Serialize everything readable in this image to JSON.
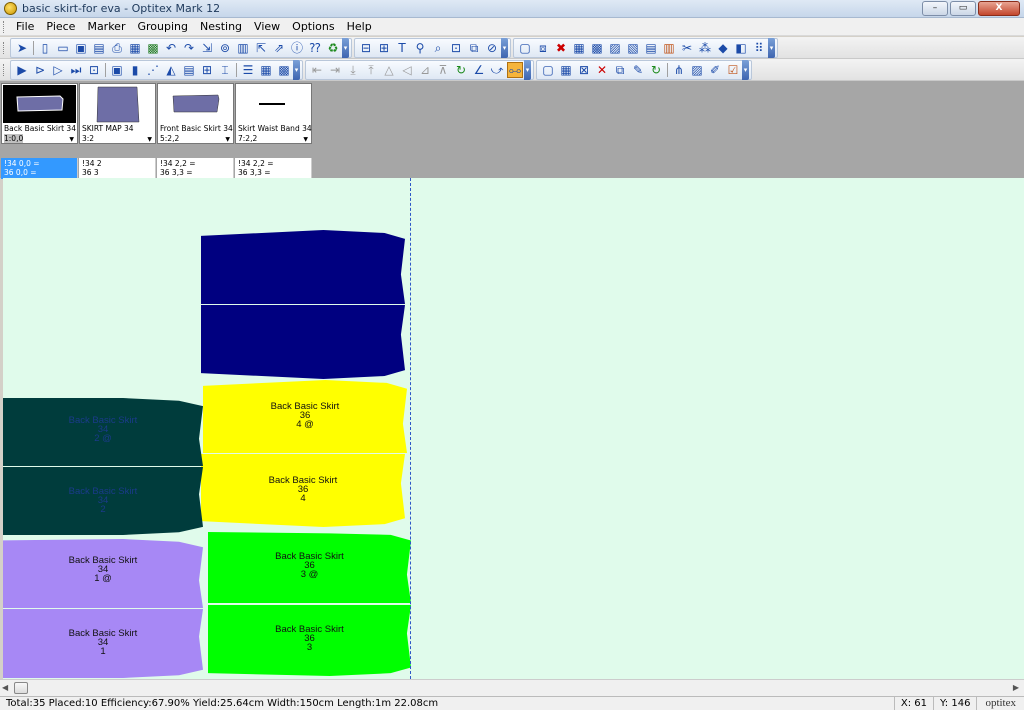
{
  "window": {
    "title": "basic skirt-for eva - Optitex Mark 12",
    "min": "–",
    "max": "▭",
    "close": "X"
  },
  "menu": [
    "File",
    "Piece",
    "Marker",
    "Grouping",
    "Nesting",
    "View",
    "Options",
    "Help"
  ],
  "thumbnails": [
    {
      "name": "Back Basic Skirt 34",
      "count": "1:0,0",
      "sizes": [
        "!34  0,0 =",
        "36  0,0 ="
      ],
      "selected": true
    },
    {
      "name": "SKIRT MAP 34",
      "count": "3:2",
      "sizes": [
        "!34  2",
        "36  3"
      ],
      "selected": false
    },
    {
      "name": "Front Basic Skirt 34",
      "count": "5:2,2",
      "sizes": [
        "!34  2,2 =",
        "36  3,3 ="
      ],
      "selected": false
    },
    {
      "name": "Skirt Waist Band 34",
      "count": "7:2,2",
      "sizes": [
        "!34  2,2 =",
        "36  3,3 ="
      ],
      "selected": false
    }
  ],
  "pieces": [
    {
      "id": "navy-top",
      "color": "#000080",
      "lines": [
        "",
        "",
        ""
      ]
    },
    {
      "id": "navy-bottom",
      "color": "#000080",
      "lines": [
        "",
        "",
        ""
      ]
    },
    {
      "id": "yellow-top",
      "color": "#ffff00",
      "lines": [
        "Back Basic Skirt",
        "36",
        "4 @"
      ]
    },
    {
      "id": "yellow-bottom",
      "color": "#ffff00",
      "lines": [
        "Back Basic Skirt",
        "36",
        "4"
      ]
    },
    {
      "id": "teal-top",
      "color": "#003c3c",
      "lines": [
        "Back Basic Skirt",
        "34",
        "2 @"
      ]
    },
    {
      "id": "teal-bottom",
      "color": "#003c3c",
      "lines": [
        "Back Basic Skirt",
        "34",
        "2"
      ]
    },
    {
      "id": "green-top",
      "color": "#00ff00",
      "lines": [
        "Back Basic Skirt",
        "36",
        "3 @"
      ]
    },
    {
      "id": "green-bottom",
      "color": "#00ff00",
      "lines": [
        "Back Basic Skirt",
        "36",
        "3"
      ]
    },
    {
      "id": "purple-top",
      "color": "#a788f5",
      "lines": [
        "Back Basic Skirt",
        "34",
        "1 @"
      ]
    },
    {
      "id": "purple-bottom",
      "color": "#a788f5",
      "lines": [
        "Back Basic Skirt",
        "34",
        "1"
      ]
    }
  ],
  "status": {
    "summary": "Total:35  Placed:10  Efficiency:67.90%  Yield:25.64cm  Width:150cm  Length:1m 22.08cm",
    "x": "X: 61",
    "y": "Y: 146",
    "brand": "optitex"
  }
}
